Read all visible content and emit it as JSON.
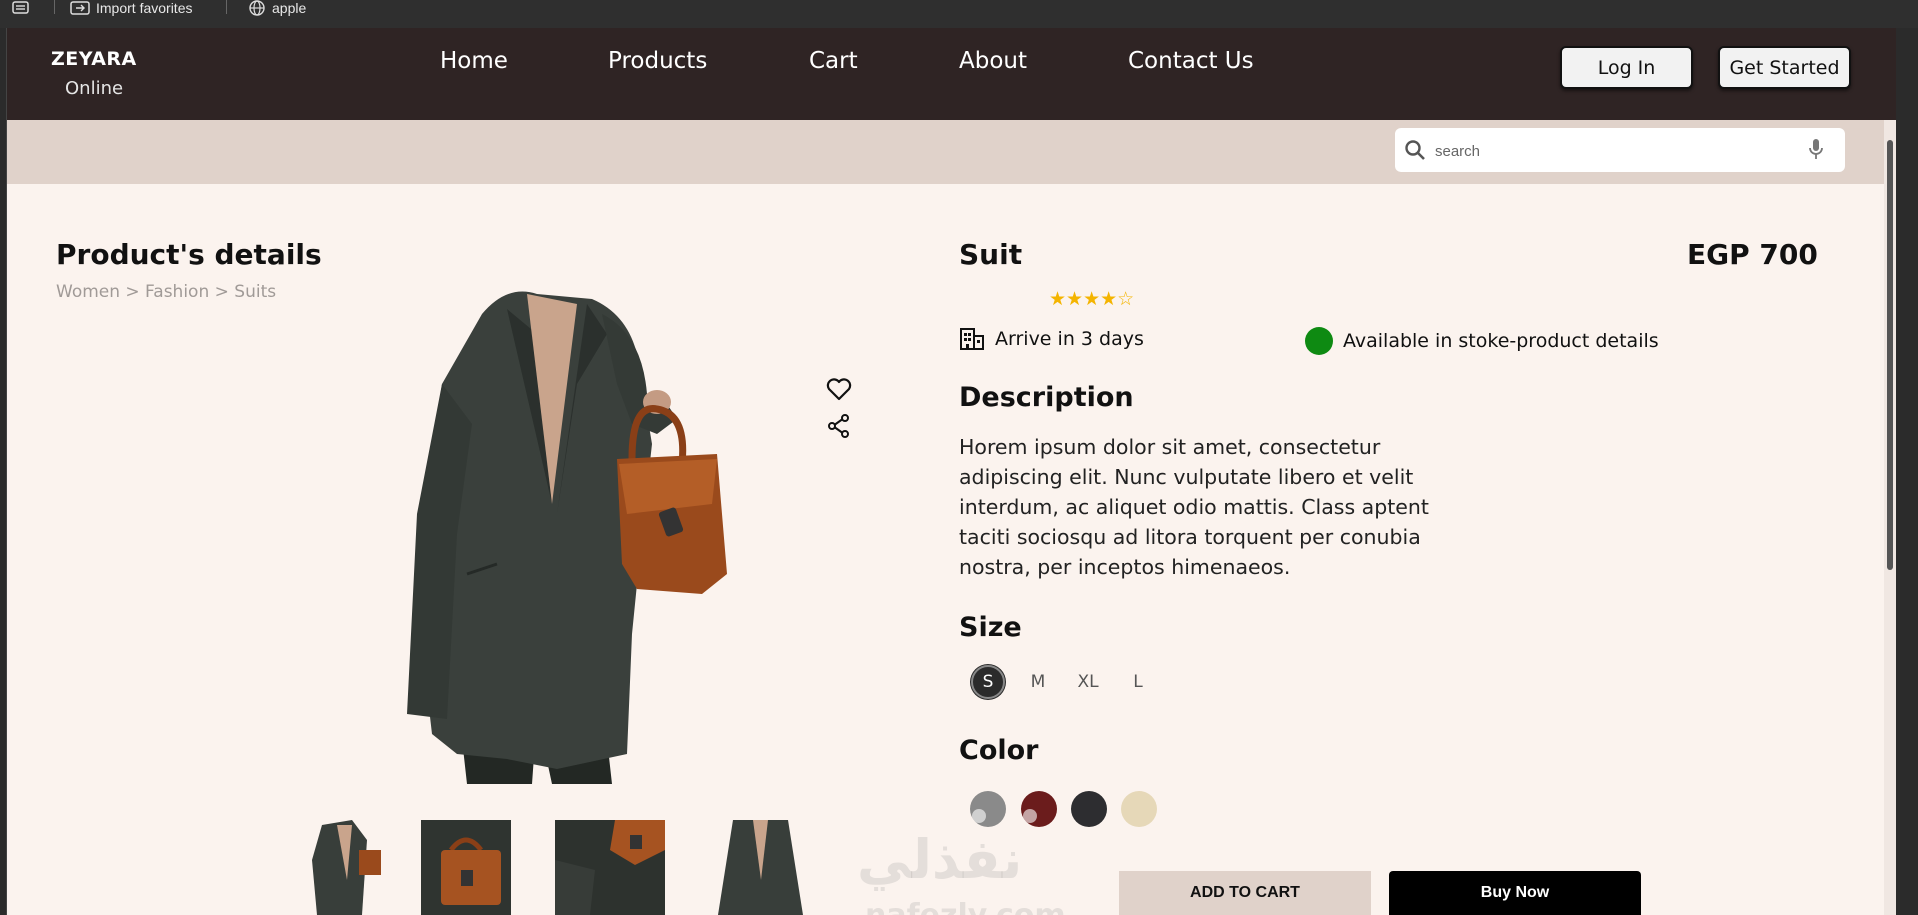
{
  "favorites": {
    "import_label": "Import favorites",
    "apple_label": "apple"
  },
  "brand": {
    "name": "ZEYARA",
    "tagline": "Online"
  },
  "nav": {
    "home": "Home",
    "products": "Products",
    "cart": "Cart",
    "about": "About",
    "contact": "Contact Us"
  },
  "auth": {
    "login": "Log In",
    "get_started": "Get Started"
  },
  "search": {
    "placeholder": "search"
  },
  "page": {
    "title": "Product's details",
    "breadcrumb": "Women > Fashion > Suits"
  },
  "product": {
    "name": "Suit",
    "price": "EGP 700",
    "rating": 4.5,
    "stars_display": "★★★★☆",
    "delivery": "Arrive in 3 days",
    "availability": "Available in stoke-product details",
    "description_heading": "Description",
    "description": "Horem ipsum dolor sit amet, consectetur adipiscing elit. Nunc vulputate libero et velit interdum, ac aliquet odio mattis. Class aptent taciti sociosqu ad litora torquent per conubia nostra, per inceptos himenaeos.",
    "size_heading": "Size",
    "sizes": [
      "S",
      "M",
      "XL",
      "L"
    ],
    "selected_size": "S",
    "color_heading": "Color",
    "colors": [
      "#8a8a8a",
      "#6b1c1c",
      "#2d2d30",
      "#e6d8b8"
    ]
  },
  "actions": {
    "add_to_cart": "ADD TO CART",
    "buy_now": "Buy Now"
  },
  "watermark": {
    "arabic": "نفذلي",
    "latin": "nafezly.com"
  },
  "theme": {
    "header_bg": "#2f2424",
    "band_bg": "#e0d2ca",
    "page_bg": "#fbf3ee",
    "available_green": "#0e8a12",
    "star_color": "#f4b400"
  }
}
